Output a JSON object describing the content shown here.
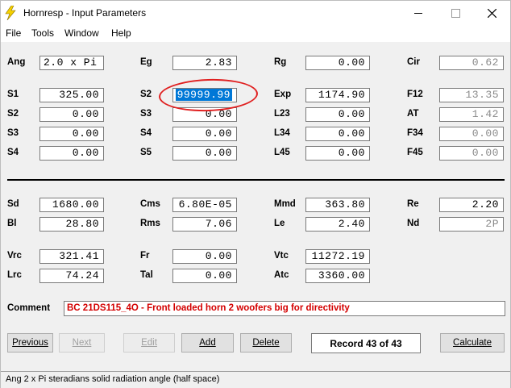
{
  "titlebar": {
    "title": "Hornresp - Input Parameters",
    "icon": "lightning-bolt-icon"
  },
  "window_controls": {
    "minimize": "—",
    "maximize": "☐",
    "close": "✕"
  },
  "menu": [
    "File",
    "Tools",
    "Window",
    "Help"
  ],
  "params": {
    "Ang": {
      "label": "Ang",
      "value": "2.0 x Pi"
    },
    "Eg": {
      "label": "Eg",
      "value": "2.83"
    },
    "Rg": {
      "label": "Rg",
      "value": "0.00"
    },
    "Cir": {
      "label": "Cir",
      "value": "0.62"
    },
    "S1": {
      "label": "S1",
      "value": "325.00"
    },
    "S2a": {
      "label": "S2",
      "value": "0.00"
    },
    "S3a": {
      "label": "S3",
      "value": "0.00"
    },
    "S4a": {
      "label": "S4",
      "value": "0.00"
    },
    "S2b": {
      "label": "S2",
      "value": "99999.99"
    },
    "S3b": {
      "label": "S3",
      "value": "0.00"
    },
    "S4b": {
      "label": "S4",
      "value": "0.00"
    },
    "S5": {
      "label": "S5",
      "value": "0.00"
    },
    "Exp": {
      "label": "Exp",
      "value": "1174.90"
    },
    "L23": {
      "label": "L23",
      "value": "0.00"
    },
    "L34": {
      "label": "L34",
      "value": "0.00"
    },
    "L45": {
      "label": "L45",
      "value": "0.00"
    },
    "F12": {
      "label": "F12",
      "value": "13.35"
    },
    "AT": {
      "label": "AT",
      "value": "1.42"
    },
    "F34": {
      "label": "F34",
      "value": "0.00"
    },
    "F45": {
      "label": "F45",
      "value": "0.00"
    },
    "Sd": {
      "label": "Sd",
      "value": "1680.00"
    },
    "Bl": {
      "label": "Bl",
      "value": "28.80"
    },
    "Cms": {
      "label": "Cms",
      "value": "6.80E-05"
    },
    "Rms": {
      "label": "Rms",
      "value": "7.06"
    },
    "Mmd": {
      "label": "Mmd",
      "value": "363.80"
    },
    "Le": {
      "label": "Le",
      "value": "2.40"
    },
    "Re": {
      "label": "Re",
      "value": "2.20"
    },
    "Nd": {
      "label": "Nd",
      "value": "2P"
    },
    "Vrc": {
      "label": "Vrc",
      "value": "321.41"
    },
    "Lrc": {
      "label": "Lrc",
      "value": "74.24"
    },
    "Fr": {
      "label": "Fr",
      "value": "0.00"
    },
    "Tal": {
      "label": "Tal",
      "value": "0.00"
    },
    "Vtc": {
      "label": "Vtc",
      "value": "11272.19"
    },
    "Atc": {
      "label": "Atc",
      "value": "3360.00"
    }
  },
  "comment": {
    "label": "Comment",
    "value": "BC 21DS115_4O - Front loaded horn 2 woofers big for directivity"
  },
  "buttons": {
    "previous": "Previous",
    "next": "Next",
    "edit": "Edit",
    "add": "Add",
    "delete": "Delete",
    "calculate": "Calculate"
  },
  "record": "Record 43 of 43",
  "status": "Ang   2 x Pi steradians solid radiation angle  (half space)",
  "colors": {
    "selection": "#0078d7",
    "comment_text": "#d40000",
    "annotation": "#e02020"
  }
}
